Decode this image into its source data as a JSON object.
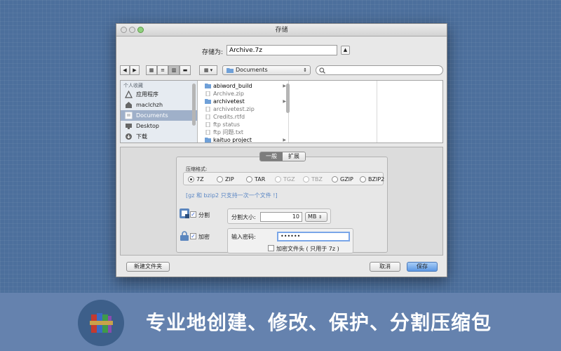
{
  "window": {
    "title": "存储",
    "save_as_label": "存储为:",
    "filename": "Archive.7z"
  },
  "toolbar": {
    "nav_back": "◀",
    "nav_forward": "▶",
    "location": "Documents"
  },
  "sidebar": {
    "section_title": "个人收藏",
    "items": [
      {
        "label": "应用程序",
        "icon": "apps-icon"
      },
      {
        "label": "maclchzh",
        "icon": "home-icon"
      },
      {
        "label": "Documents",
        "icon": "documents-icon"
      },
      {
        "label": "Desktop",
        "icon": "desktop-icon"
      },
      {
        "label": "下载",
        "icon": "download-icon"
      }
    ]
  },
  "files": [
    {
      "name": "abiword_build",
      "kind": "folder"
    },
    {
      "name": "Archive.zip",
      "kind": "file"
    },
    {
      "name": "archivetest",
      "kind": "folder"
    },
    {
      "name": "archivetest.zip",
      "kind": "file"
    },
    {
      "name": "Credits.rtfd",
      "kind": "file"
    },
    {
      "name": "ftp status",
      "kind": "file"
    },
    {
      "name": "ftp 问题.txt",
      "kind": "file"
    },
    {
      "name": "kaituo project",
      "kind": "folder"
    }
  ],
  "options": {
    "tab_general": "一般",
    "tab_extended": "扩展",
    "format_label": "压缩格式:",
    "formats": [
      {
        "label": "7Z",
        "state": "checked"
      },
      {
        "label": "ZIP",
        "state": "enabled"
      },
      {
        "label": "TAR",
        "state": "enabled"
      },
      {
        "label": "TGZ",
        "state": "disabled"
      },
      {
        "label": "TBZ",
        "state": "disabled"
      },
      {
        "label": "GZIP",
        "state": "enabled"
      },
      {
        "label": "BZIP2",
        "state": "enabled"
      }
    ],
    "hint": "[gz 和 bzip2 只支持一次一个文件 !]",
    "split_label": "分割",
    "split_size_label": "分割大小:",
    "split_size_value": "10",
    "split_unit": "MB",
    "encrypt_label": "加密",
    "password_label": "输入密码:",
    "password_value": "••••••",
    "encrypt_header_label": "加密文件头 ( 只用于 7z )"
  },
  "buttons": {
    "new_folder": "新建文件夹",
    "cancel": "取消",
    "save": "保存"
  },
  "banner": {
    "slogan": "专业地创建、修改、保护、分割压缩包"
  }
}
